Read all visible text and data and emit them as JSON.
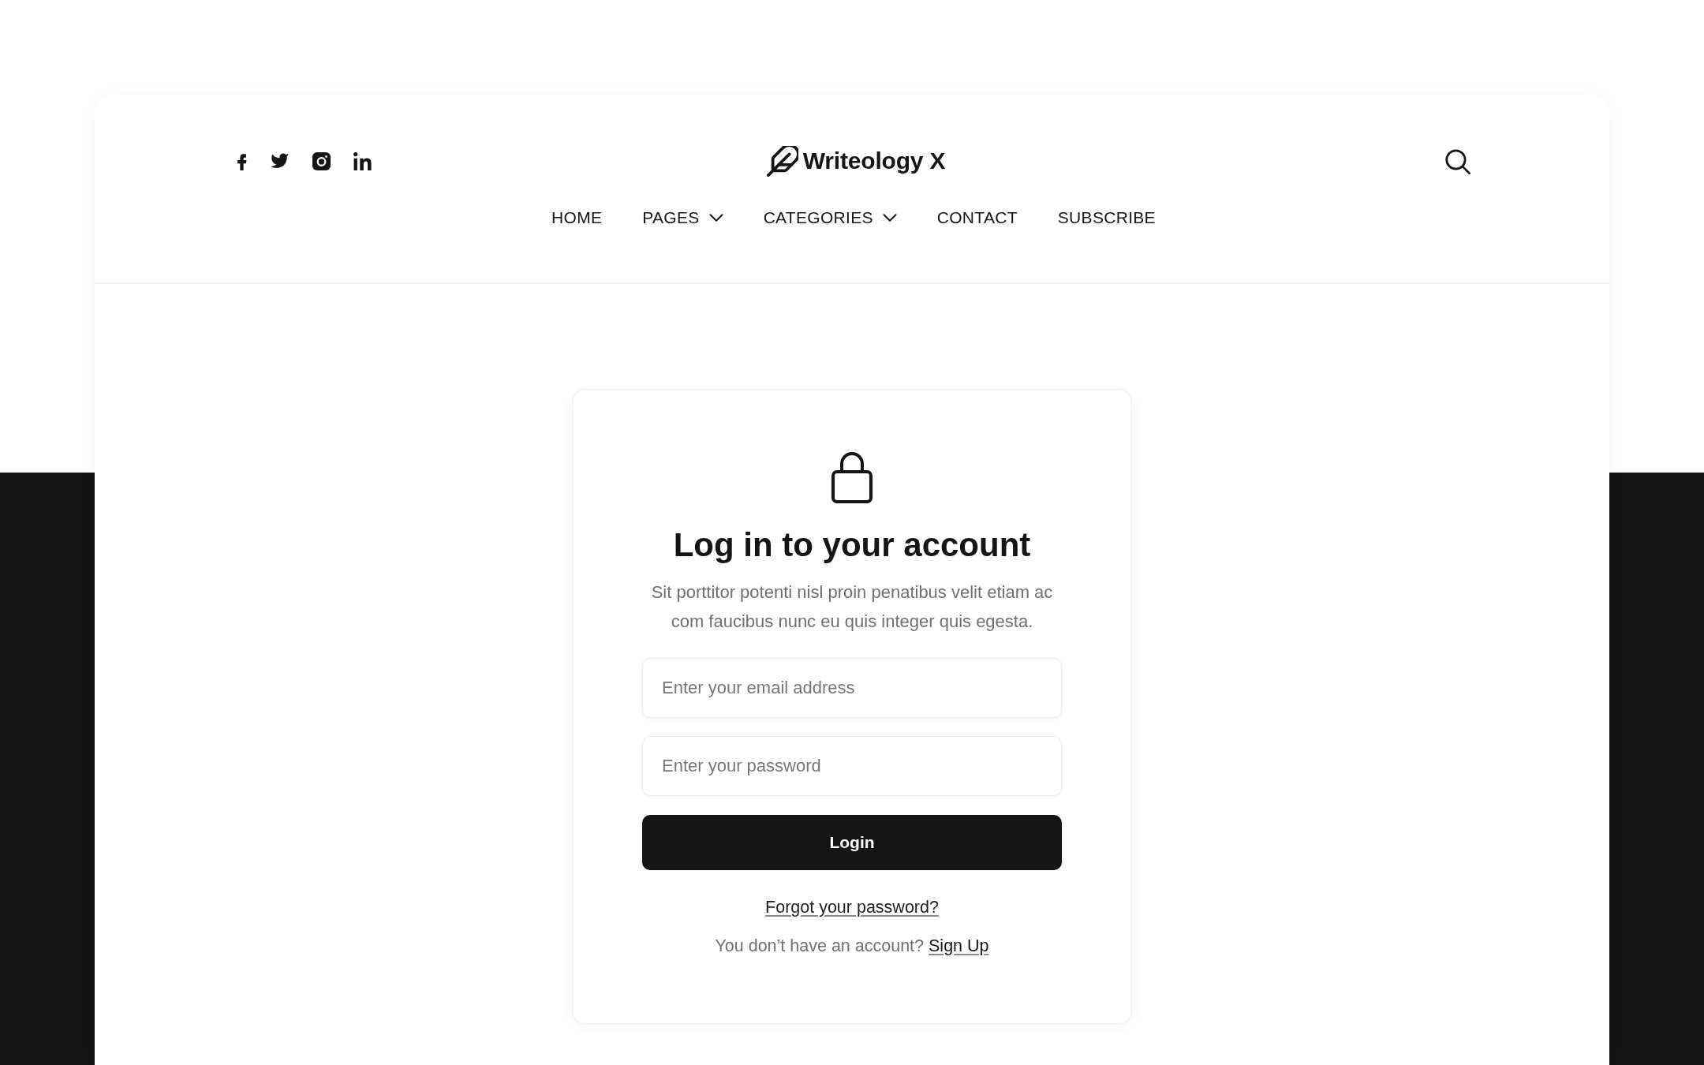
{
  "header": {
    "logo": "Writeology X",
    "nav": [
      {
        "label": "HOME",
        "dropdown": false
      },
      {
        "label": "PAGES",
        "dropdown": true
      },
      {
        "label": "CATEGORIES",
        "dropdown": true
      },
      {
        "label": "CONTACT",
        "dropdown": false
      },
      {
        "label": "SUBSCRIBE",
        "dropdown": false
      }
    ]
  },
  "login_card": {
    "title": "Log in to your account",
    "description": "Sit porttitor potenti nisl proin penatibus velit etiam ac com faucibus nunc eu quis integer quis egesta.",
    "fields": [
      {
        "placeholder": "Enter your email address"
      },
      {
        "placeholder": "Enter your password"
      }
    ],
    "submit_button": "Login",
    "forgot_link": "Forgot your password?",
    "signup_prompt": "You don’t have an account?",
    "signup_link": "Sign Up"
  }
}
